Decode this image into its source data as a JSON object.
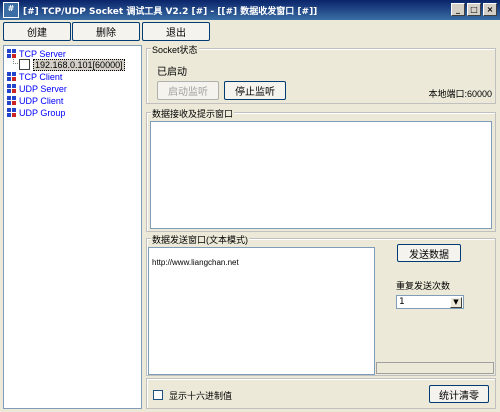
{
  "window": {
    "title": "[#] TCP/UDP Socket 调试工具 V2.2 [#] - [[#] 数据收发窗口 [#]]",
    "icon_glyph": "#",
    "minimize_glyph": "_",
    "maximize_glyph": "□",
    "close_glyph": "×"
  },
  "toolbar": {
    "create_label": "创建",
    "delete_label": "删除",
    "exit_label": "退出"
  },
  "tree": {
    "items": [
      {
        "label": "TCP Server",
        "color": "#0000ff"
      },
      {
        "label": "192.168.0.101[60000]",
        "color": "#000000"
      },
      {
        "label": "TCP Client",
        "color": "#0000ff"
      },
      {
        "label": "UDP Server",
        "color": "#0000ff"
      },
      {
        "label": "UDP Client",
        "color": "#0000ff"
      },
      {
        "label": "UDP Group",
        "color": "#0000ff"
      }
    ]
  },
  "socket_status": {
    "legend": "Socket状态",
    "status": "已启动",
    "start_label": "启动监听",
    "stop_label": "停止监听",
    "local_port_label": "本地端口:60000"
  },
  "receive": {
    "legend": "数据接收及提示窗口",
    "content": ""
  },
  "send": {
    "legend": "数据发送窗口(文本模式)",
    "content": "http://www.liangchan.net",
    "send_label": "发送数据",
    "repeat_label": "重复发送次数",
    "repeat_value": "1"
  },
  "footer": {
    "hex_label": "显示十六进制值",
    "stats_label": "统计清零"
  }
}
